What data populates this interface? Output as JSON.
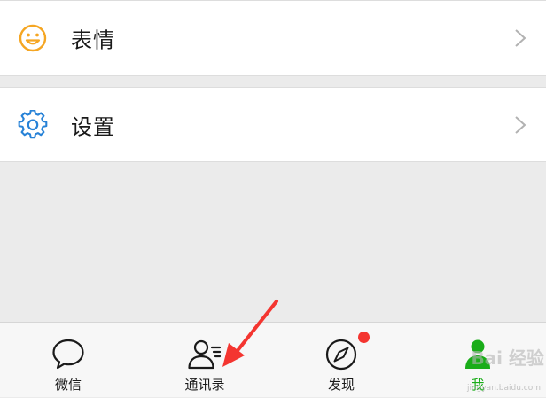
{
  "menu": {
    "items": [
      {
        "label": "表情",
        "icon": "smiley-icon",
        "icon_color": "#f5a623"
      },
      {
        "label": "设置",
        "icon": "gear-icon",
        "icon_color": "#2782d7"
      }
    ]
  },
  "tabbar": {
    "tabs": [
      {
        "label": "微信",
        "icon": "chat-bubble-icon",
        "active": false
      },
      {
        "label": "通讯录",
        "icon": "contacts-icon",
        "active": false
      },
      {
        "label": "发现",
        "icon": "compass-icon",
        "active": false,
        "badge": true
      },
      {
        "label": "我",
        "icon": "person-icon",
        "active": true
      }
    ],
    "active_color": "#1aad19",
    "badge_color": "#f43530"
  },
  "annotation": {
    "icon": "red-arrow-icon",
    "color": "#f43530"
  },
  "watermark": {
    "text": "Bai 经验",
    "sub": "jingyan.baidu.com"
  }
}
